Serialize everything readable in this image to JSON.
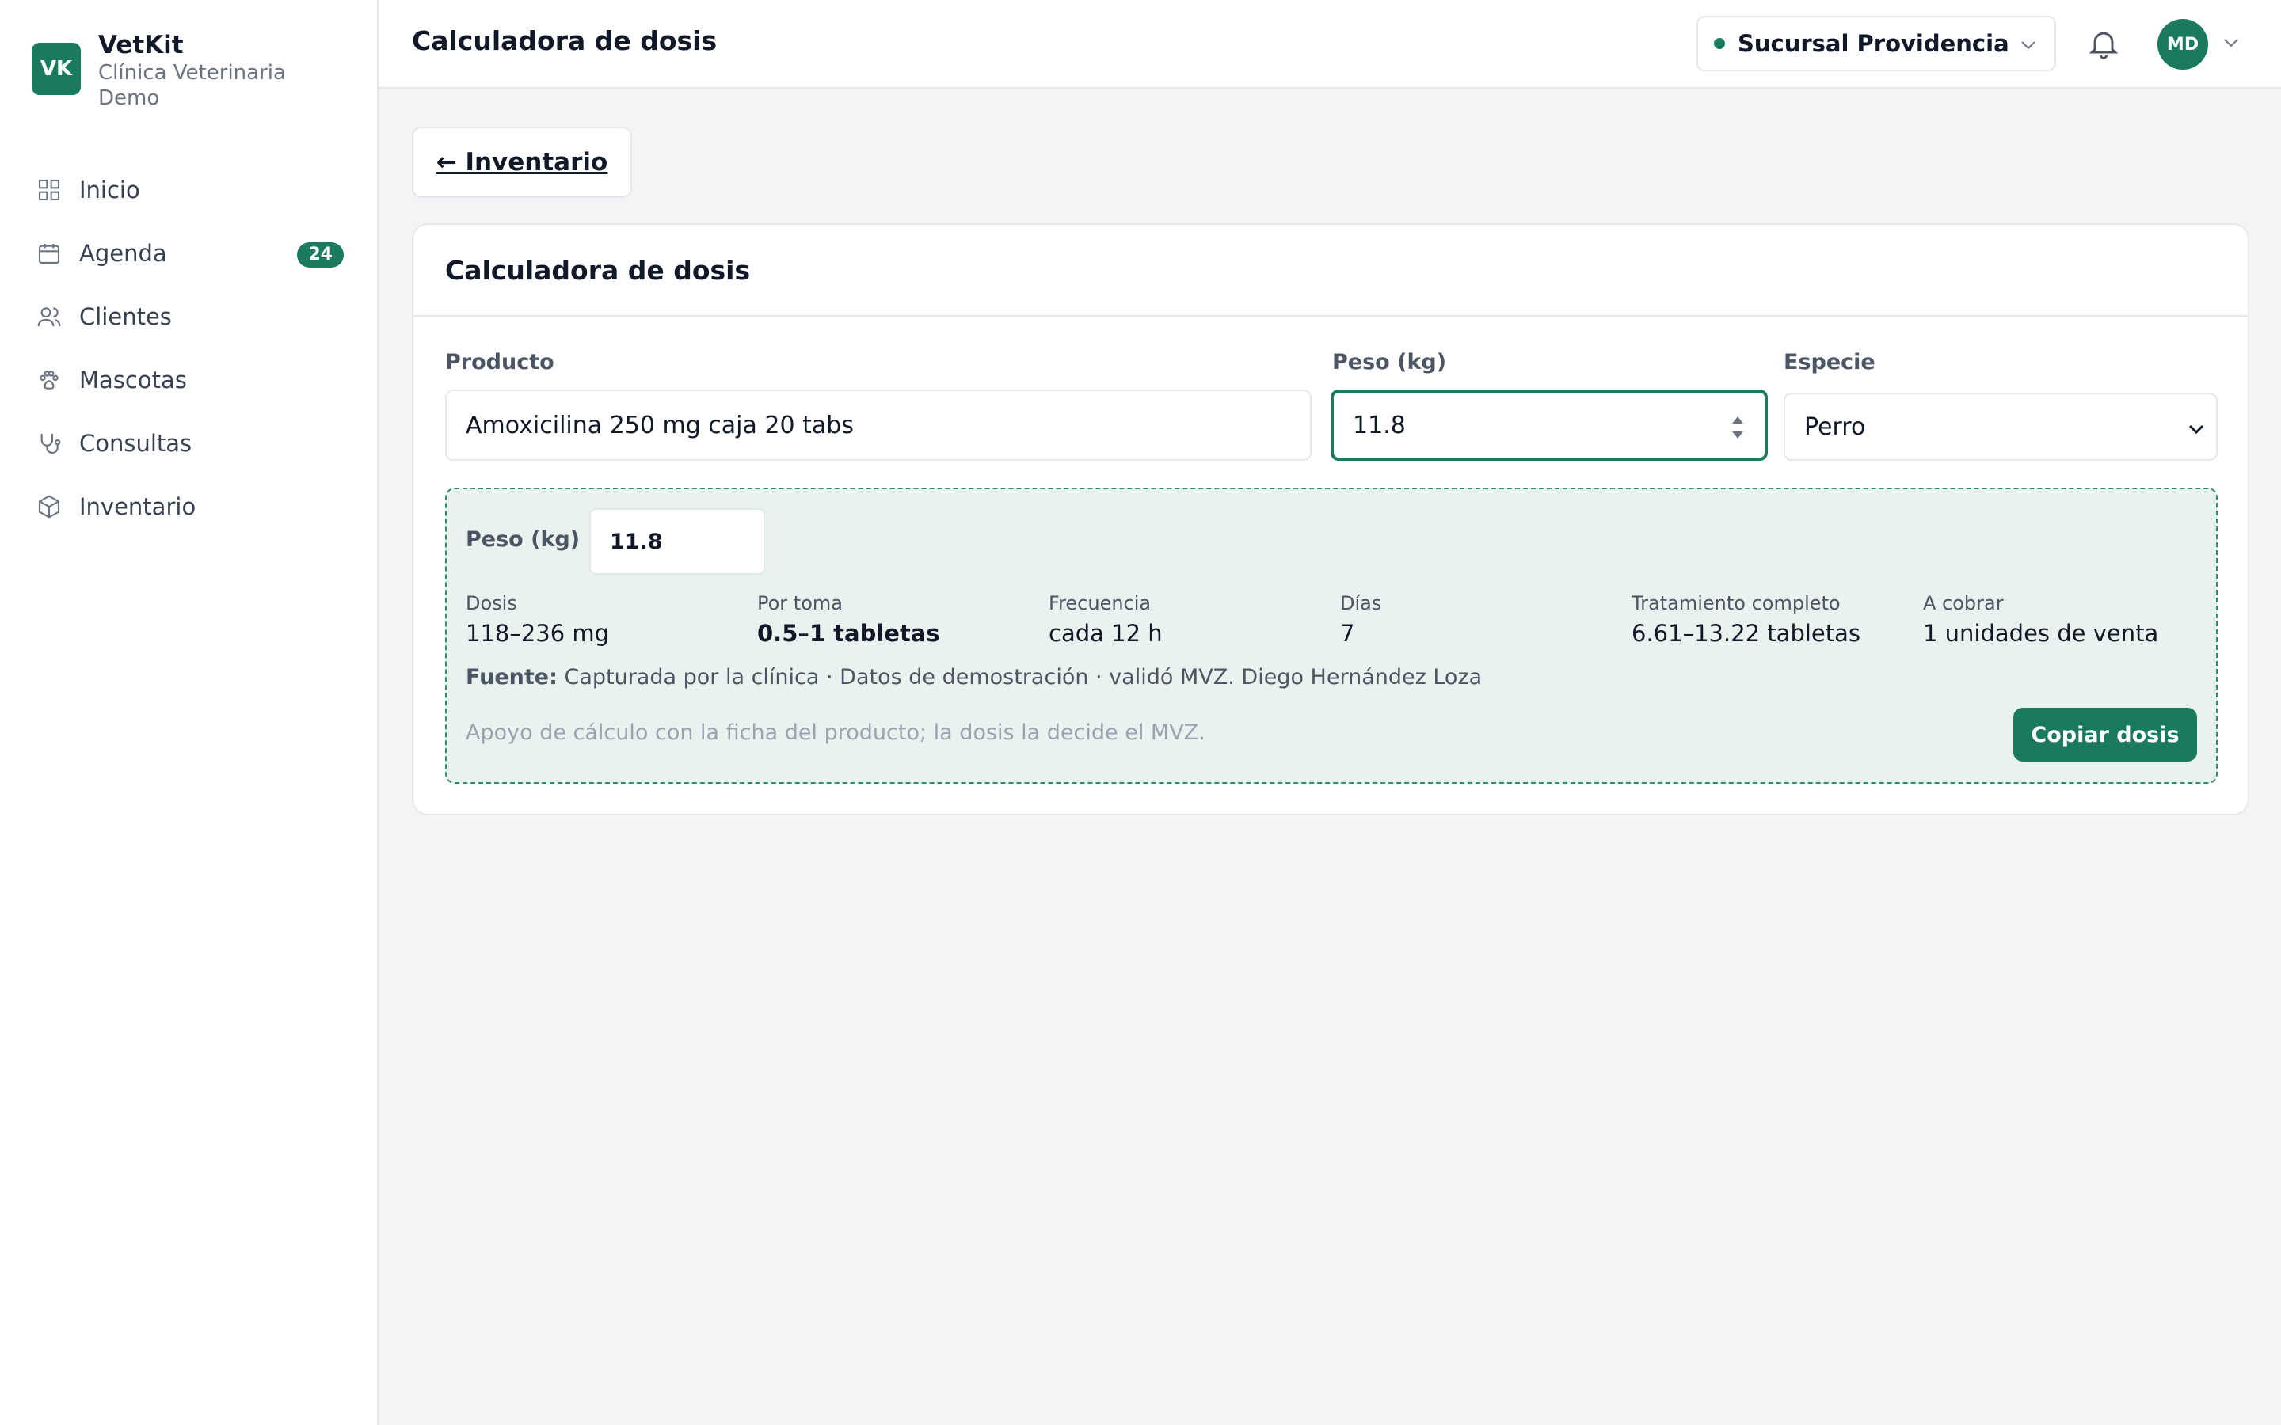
{
  "brand": {
    "logo_text": "VK",
    "name": "VetKit",
    "subtitle": "Clínica Veterinaria Demo"
  },
  "sidebar": {
    "items": [
      {
        "label": "Inicio",
        "icon": "grid-icon"
      },
      {
        "label": "Agenda",
        "icon": "calendar-icon",
        "badge": "24"
      },
      {
        "label": "Clientes",
        "icon": "users-icon"
      },
      {
        "label": "Mascotas",
        "icon": "paw-icon"
      },
      {
        "label": "Consultas",
        "icon": "stethoscope-icon"
      },
      {
        "label": "Inventario",
        "icon": "box-icon"
      }
    ]
  },
  "header": {
    "title": "Calculadora de dosis",
    "branch": "Sucursal Providencia",
    "avatar_initials": "MD"
  },
  "back_button": "← Inventario",
  "card": {
    "title": "Calculadora de dosis",
    "fields": {
      "product_label": "Producto",
      "product_value": "Amoxicilina 250 mg caja 20 tabs",
      "weight_label": "Peso (kg)",
      "weight_value": "11.8",
      "species_label": "Especie",
      "species_value": "Perro"
    },
    "result": {
      "weight_label": "Peso (kg)",
      "weight_value": "11.8",
      "metrics": [
        {
          "label": "Dosis",
          "value": "118–236 mg"
        },
        {
          "label": "Por toma",
          "value": "0.5–1 tabletas"
        },
        {
          "label": "Frecuencia",
          "value": "cada 12 h"
        },
        {
          "label": "Días",
          "value": "7"
        },
        {
          "label": "Tratamiento completo",
          "value": "6.61–13.22 tabletas"
        },
        {
          "label": "A cobrar",
          "value": "1 unidades de venta"
        }
      ],
      "source_label": "Fuente:",
      "source_text": "Capturada por la clínica · Datos de demostración · validó MVZ. Diego Hernández Loza",
      "note": "Apoyo de cálculo con la ficha del producto; la dosis la decide el MVZ.",
      "copy_button": "Copiar dosis"
    }
  },
  "colors": {
    "accent": "#1a7a5e",
    "result_bg": "#e8f3ef",
    "page_bg": "#f3f4f6"
  }
}
